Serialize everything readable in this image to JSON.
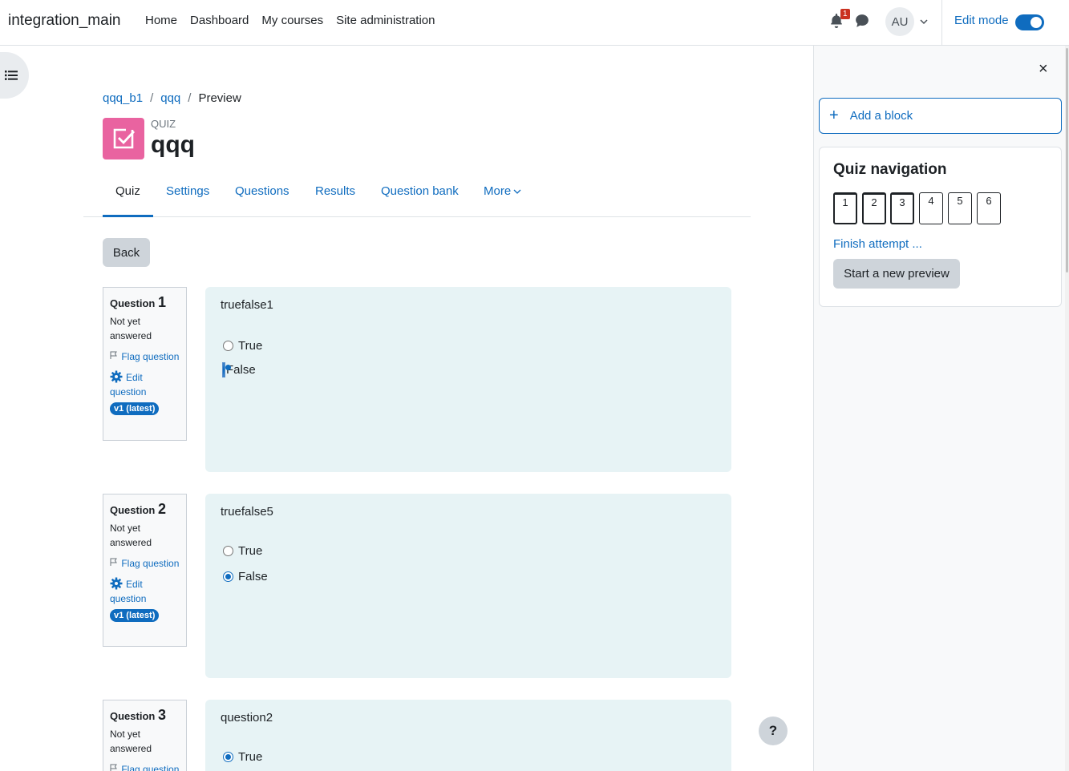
{
  "navbar": {
    "brand": "integration_main",
    "items": [
      "Home",
      "Dashboard",
      "My courses",
      "Site administration"
    ],
    "notification_count": "1",
    "avatar_initials": "AU",
    "edit_mode_label": "Edit mode",
    "edit_mode_on": true
  },
  "breadcrumb": [
    "qqq_b1",
    "qqq",
    "Preview"
  ],
  "header": {
    "kicker": "QUIZ",
    "title": "qqq"
  },
  "tabs": [
    "Quiz",
    "Settings",
    "Questions",
    "Results",
    "Question bank",
    "More"
  ],
  "active_tab": "Quiz",
  "back_label": "Back",
  "question_label": "Question",
  "questions": [
    {
      "number": "1",
      "state": "Not yet answered",
      "flag_label": "Flag question",
      "edit_label": "Edit question",
      "version_badge": "v1 (latest)",
      "text": "truefalse1",
      "answers": [
        {
          "label": "True",
          "checked": false
        },
        {
          "label": "False",
          "checked": true,
          "focused": true
        }
      ]
    },
    {
      "number": "2",
      "state": "Not yet answered",
      "flag_label": "Flag question",
      "edit_label": "Edit question",
      "version_badge": "v1 (latest)",
      "text": "truefalse5",
      "answers": [
        {
          "label": "True",
          "checked": false
        },
        {
          "label": "False",
          "checked": true
        }
      ]
    },
    {
      "number": "3",
      "state": "Not yet answered",
      "flag_label": "Flag question",
      "text": "question2",
      "answers": [
        {
          "label": "True",
          "checked": true
        }
      ]
    }
  ],
  "help_label": "?",
  "drawer": {
    "close_symbol": "×",
    "add_block_label": "Add a block",
    "quiz_navigation_title": "Quiz navigation",
    "nav_buttons": [
      {
        "label": "1",
        "answered": true
      },
      {
        "label": "2",
        "answered": true
      },
      {
        "label": "3",
        "answered": true
      },
      {
        "label": "4",
        "answered": false
      },
      {
        "label": "5",
        "answered": false
      },
      {
        "label": "6",
        "answered": false
      }
    ],
    "finish_attempt_label": "Finish attempt ...",
    "start_new_preview_label": "Start a new preview"
  },
  "colors": {
    "accent": "#0f6cbf",
    "quiz_icon": "#e963a0",
    "question_bg": "#e7f3f5",
    "notification": "#ca3120"
  }
}
